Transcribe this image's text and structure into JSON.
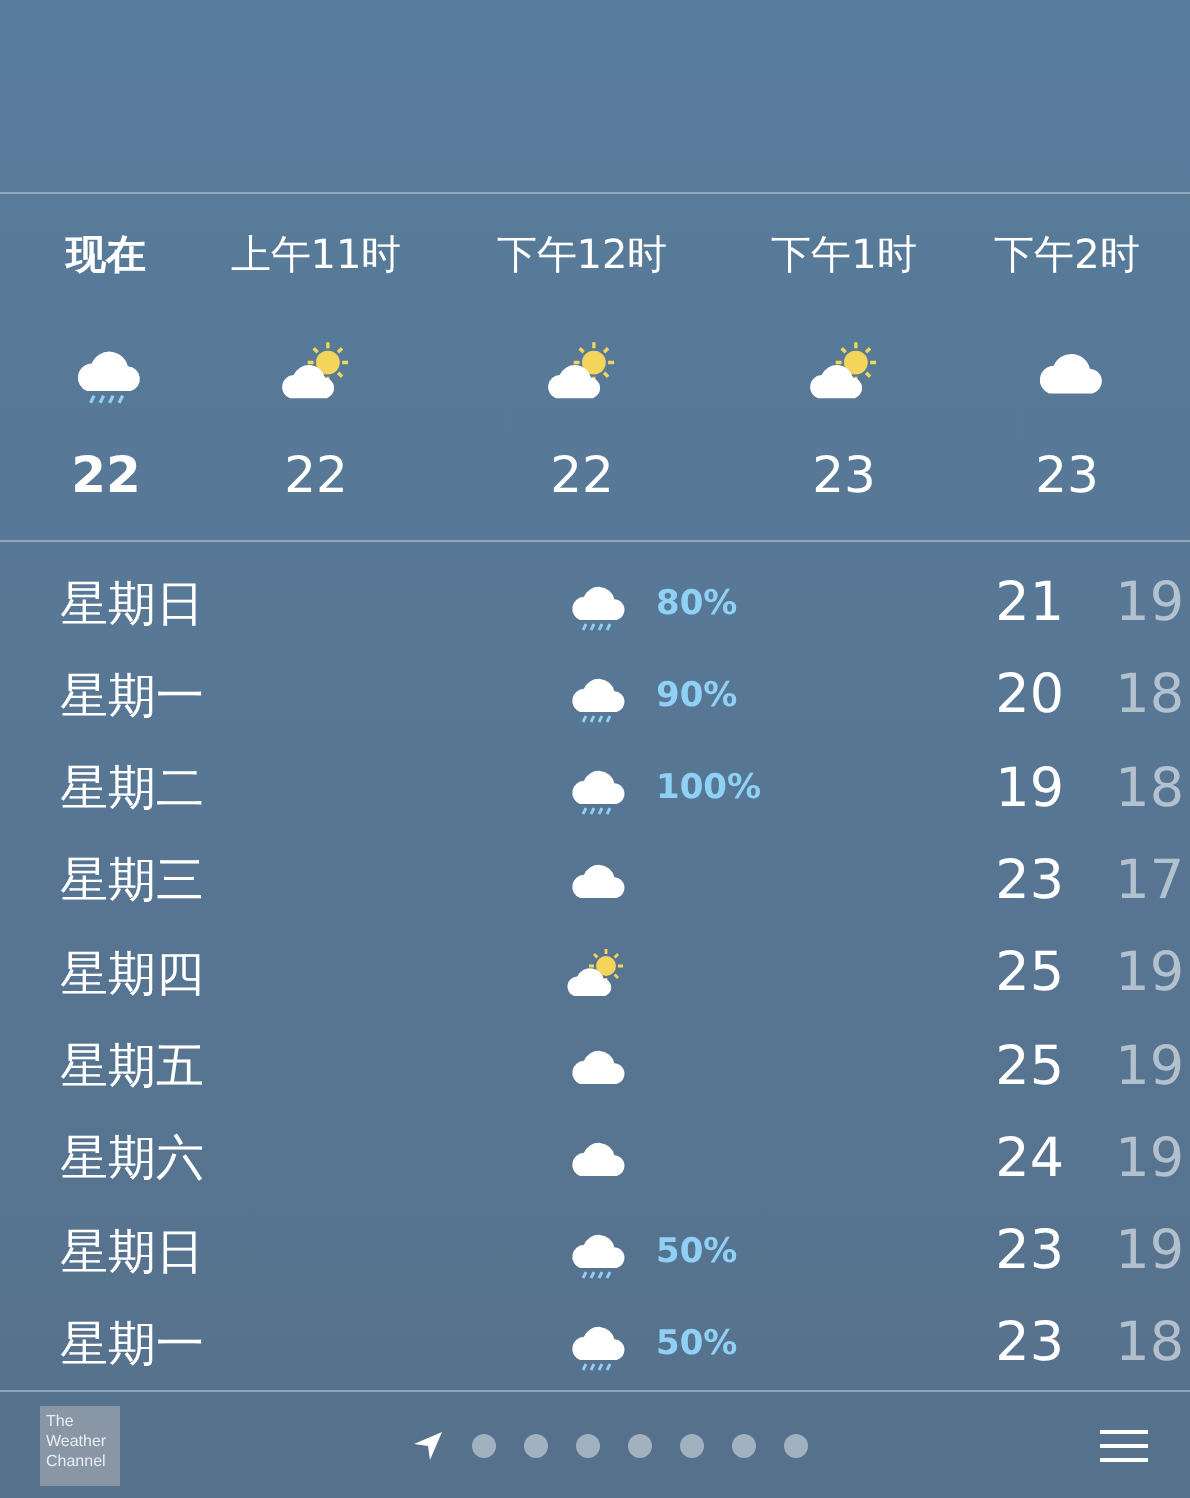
{
  "hourly": [
    {
      "time": "现在",
      "kind": "rain",
      "temp": "22",
      "current": true
    },
    {
      "time": "上午11时",
      "kind": "partly_sunny",
      "temp": "22",
      "current": false
    },
    {
      "time": "下午12时",
      "kind": "partly_sunny",
      "temp": "22",
      "current": false
    },
    {
      "time": "下午1时",
      "kind": "partly_sunny",
      "temp": "23",
      "current": false
    },
    {
      "time": "下午2时",
      "kind": "cloudy",
      "temp": "23",
      "current": false
    }
  ],
  "daily": [
    {
      "day": "星期日",
      "kind": "rain",
      "chance": "80%",
      "high": "21",
      "low": "19"
    },
    {
      "day": "星期一",
      "kind": "rain",
      "chance": "90%",
      "high": "20",
      "low": "18"
    },
    {
      "day": "星期二",
      "kind": "rain",
      "chance": "100%",
      "high": "19",
      "low": "18"
    },
    {
      "day": "星期三",
      "kind": "cloudy",
      "high": "23",
      "low": "17"
    },
    {
      "day": "星期四",
      "kind": "partly_sunny",
      "high": "25",
      "low": "19"
    },
    {
      "day": "星期五",
      "kind": "cloudy",
      "high": "25",
      "low": "19"
    },
    {
      "day": "星期六",
      "kind": "cloudy",
      "high": "24",
      "low": "19"
    },
    {
      "day": "星期日",
      "kind": "rain",
      "chance": "50%",
      "high": "23",
      "low": "19"
    },
    {
      "day": "星期一",
      "kind": "rain",
      "chance": "50%",
      "high": "23",
      "low": "18"
    }
  ],
  "footer": {
    "logo": "The Weather Channel",
    "pages": [
      {
        "kind": "location",
        "selected": true
      },
      {
        "kind": "dot",
        "selected": false
      },
      {
        "kind": "dot",
        "selected": false
      },
      {
        "kind": "dot",
        "selected": false
      },
      {
        "kind": "dot",
        "selected": false
      },
      {
        "kind": "dot",
        "selected": false
      },
      {
        "kind": "dot",
        "selected": false
      },
      {
        "kind": "dot",
        "selected": false
      }
    ]
  }
}
